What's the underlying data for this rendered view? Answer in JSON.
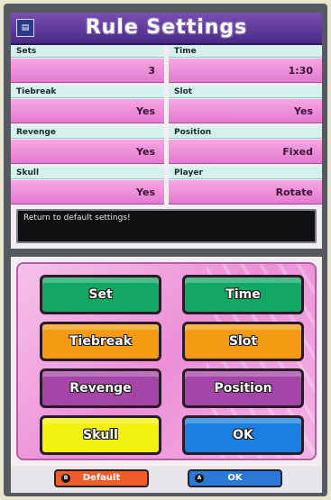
{
  "title": "Rule Settings",
  "settings": [
    {
      "label": "Sets",
      "value": "3"
    },
    {
      "label": "Time",
      "value": "1:30"
    },
    {
      "label": "Tiebreak",
      "value": "Yes"
    },
    {
      "label": "Slot",
      "value": "Yes"
    },
    {
      "label": "Revenge",
      "value": "Yes"
    },
    {
      "label": "Position",
      "value": "Fixed"
    },
    {
      "label": "Skull",
      "value": "Yes"
    },
    {
      "label": "Player",
      "value": "Rotate"
    }
  ],
  "message": "Return to default settings!",
  "buttons": {
    "set": "Set",
    "time": "Time",
    "tiebreak": "Tiebreak",
    "slot": "Slot",
    "revenge": "Revenge",
    "position": "Position",
    "skull": "Skull",
    "ok": "OK"
  },
  "bottom_bar": {
    "default_label": "Default",
    "default_icon": "B",
    "ok_label": "OK",
    "ok_icon": "A"
  },
  "colors": {
    "title_bar": "#5a3596",
    "label_bg": "#d5f1ee",
    "value_bg": "#ec8fd8",
    "green": "#12a864",
    "orange": "#f59a13",
    "purple": "#a545a8",
    "yellow": "#f3f20e",
    "blue": "#1c7fe0",
    "default_pill": "#f25b2a"
  }
}
